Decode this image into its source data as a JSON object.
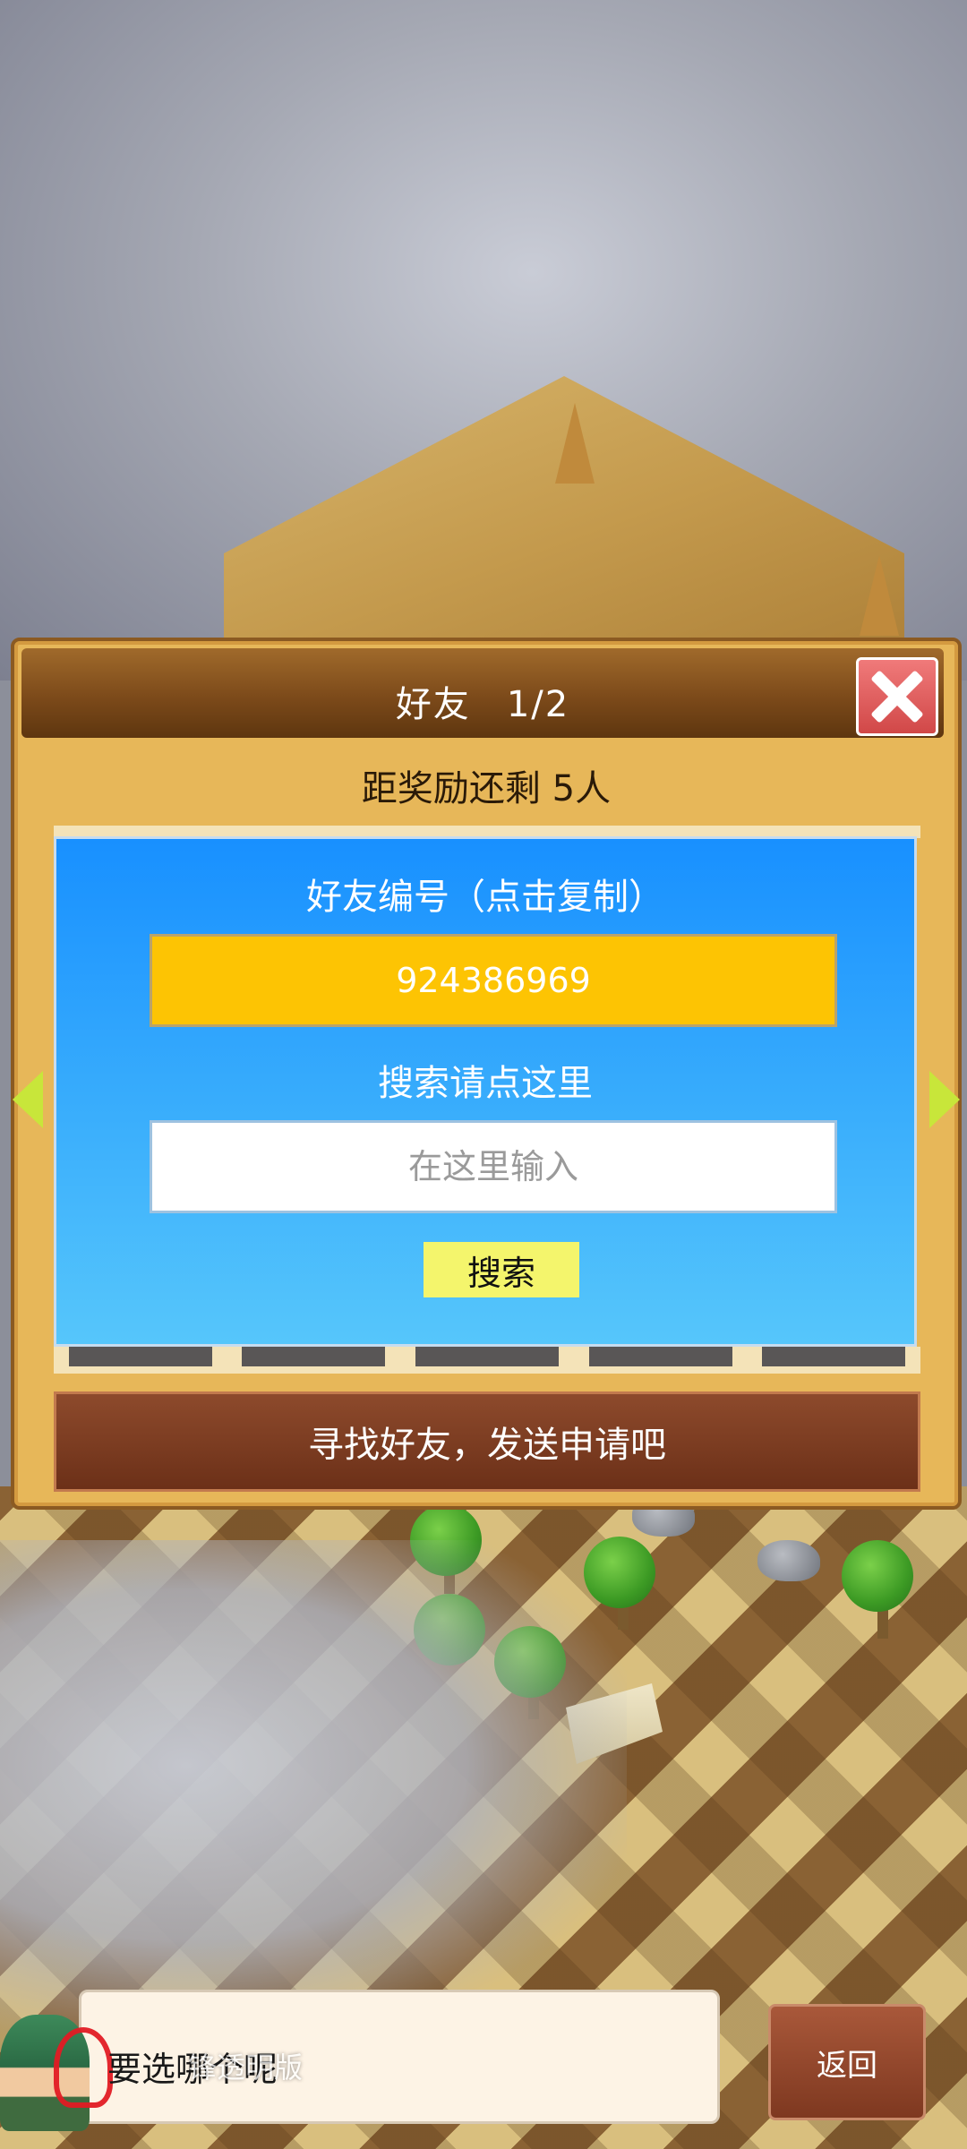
{
  "dialog": {
    "title": "好友",
    "page": "1/2",
    "reward_text": "距奖励还剩 5人",
    "friend_id_label": "好友编号（点击复制）",
    "friend_id": "924386969",
    "search_label": "搜索请点这里",
    "search_placeholder": "在这里输入",
    "search_button": "搜索",
    "find_button": "寻找好友，发送申请吧",
    "close_icon": "close-icon",
    "arrow_left_icon": "arrow-left-icon",
    "arrow_right_icon": "arrow-right-icon"
  },
  "bottom_bar": {
    "speech": "要选哪个呢",
    "watermark": "锋透明版",
    "back_button": "返回"
  },
  "colors": {
    "panel_blue": "#1890ff",
    "id_box_yellow": "#fdc403",
    "search_btn_yellow": "#f4f56c",
    "find_btn_brown": "#7a3a20",
    "close_red": "#e25a5a"
  }
}
